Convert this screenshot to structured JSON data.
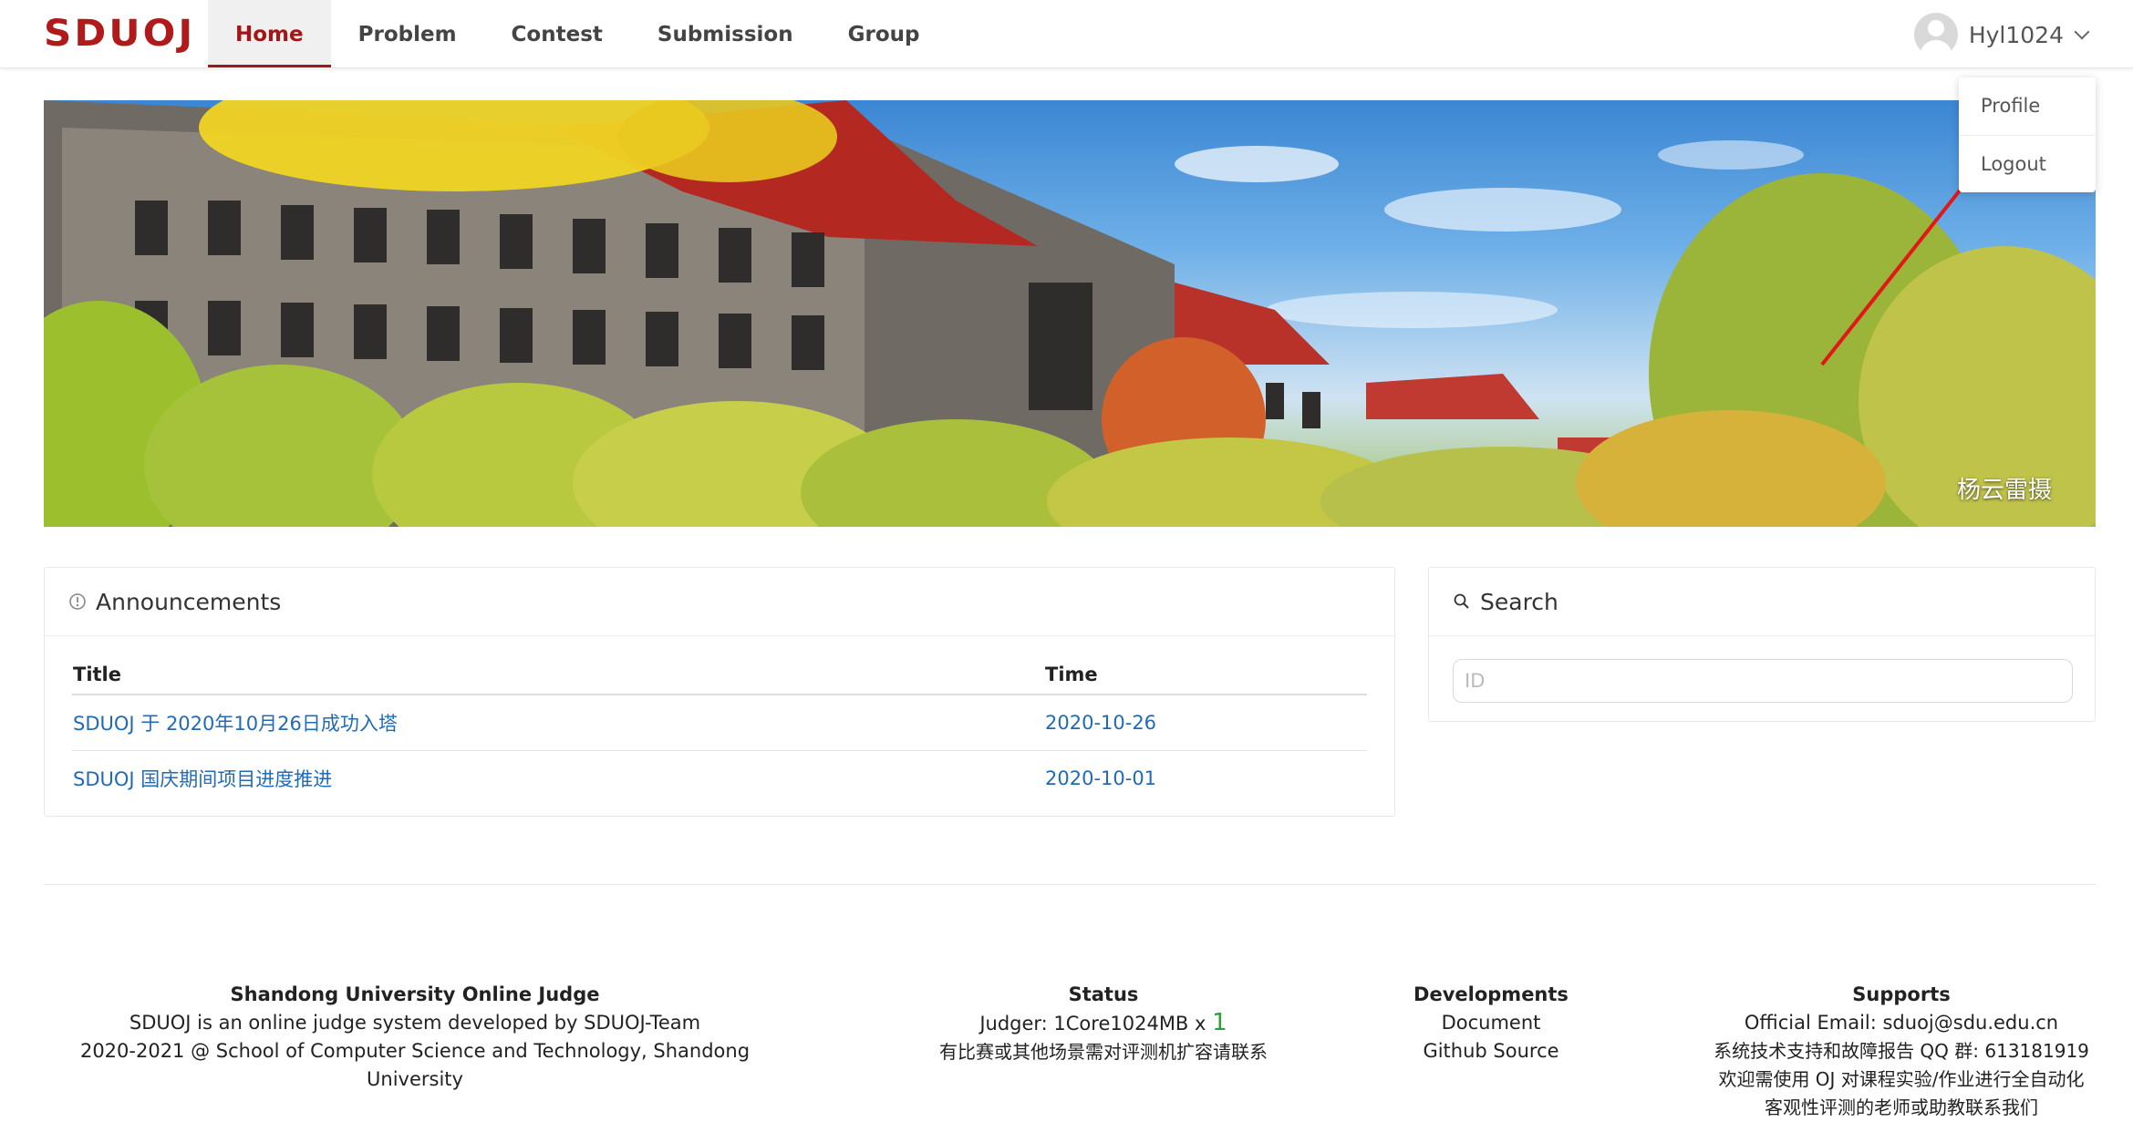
{
  "header": {
    "logo": "SDUOJ",
    "nav": [
      {
        "label": "Home",
        "active": true
      },
      {
        "label": "Problem",
        "active": false
      },
      {
        "label": "Contest",
        "active": false
      },
      {
        "label": "Submission",
        "active": false
      },
      {
        "label": "Group",
        "active": false
      }
    ],
    "username": "Hyl1024"
  },
  "user_menu": {
    "items": [
      {
        "label": "Profile"
      },
      {
        "label": "Logout"
      }
    ]
  },
  "banner": {
    "photo_credit": "杨云雷摄"
  },
  "announcements": {
    "title": "Announcements",
    "columns": [
      "Title",
      "Time"
    ],
    "rows": [
      {
        "title": "SDUOJ 于 2020年10月26日成功入塔",
        "time": "2020-10-26"
      },
      {
        "title": "SDUOJ 国庆期间项目进度推进",
        "time": "2020-10-01"
      }
    ]
  },
  "search": {
    "title": "Search",
    "placeholder": "ID",
    "value": ""
  },
  "footer": {
    "about": {
      "title": "Shandong University Online Judge",
      "line1": "SDUOJ is an online judge system developed by SDUOJ-Team",
      "line2": "2020-2021 @ School of Computer Science and Technology, Shandong",
      "line3": "University"
    },
    "status": {
      "title": "Status",
      "judger_label": "Judger: 1Core1024MB x",
      "judger_count": "1",
      "note": "有比赛或其他场景需对评测机扩容请联系"
    },
    "developments": {
      "title": "Developments",
      "links": [
        "Document",
        "Github Source"
      ]
    },
    "supports": {
      "title": "Supports",
      "line1": "Official Email: sduoj@sdu.edu.cn",
      "line2": "系统技术支持和故障报告 QQ 群: 613181919",
      "line3": "欢迎需使用 OJ 对课程实验/作业进行全自动化",
      "line4": "客观性评测的老师或助教联系我们"
    }
  },
  "colors": {
    "brand": "#a31616",
    "link": "#1f6bb8",
    "judger_count": "#2e9e3a"
  }
}
